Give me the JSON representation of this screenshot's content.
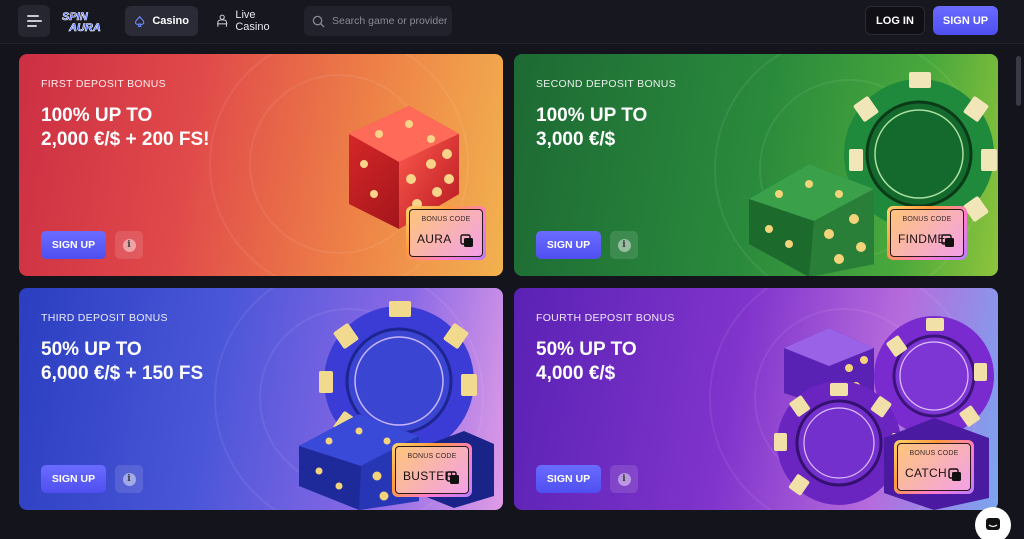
{
  "header": {
    "logo_text": "SPIN AURA",
    "tabs": [
      {
        "label": "Casino",
        "icon": "spade-icon",
        "active": true
      },
      {
        "label": "Live Casino",
        "icon": "dealer-icon",
        "active": false
      }
    ],
    "search": {
      "placeholder": "Search game or provider"
    },
    "login_label": "LOG IN",
    "signup_label": "SIGN UP"
  },
  "bonuses": [
    {
      "label": "FIRST DEPOSIT BONUS",
      "title_line1": "100% UP TO",
      "title_line2": "2,000 €/$ + 200 FS!",
      "signup_label": "SIGN UP",
      "code_label": "BONUS CODE",
      "code": "AURA",
      "color": "#e0494a"
    },
    {
      "label": "SECOND DEPOSIT BONUS",
      "title_line1": "100% UP TO",
      "title_line2": "3,000 €/$",
      "signup_label": "SIGN UP",
      "code_label": "BONUS CODE",
      "code": "FINDME",
      "color": "#2a8a3c"
    },
    {
      "label": "THIRD DEPOSIT BONUS",
      "title_line1": "50% UP TO",
      "title_line2": "6,000 €/$ + 150 FS",
      "signup_label": "SIGN UP",
      "code_label": "BONUS CODE",
      "code": "BUSTER",
      "color": "#4a56d8"
    },
    {
      "label": "FOURTH DEPOSIT BONUS",
      "title_line1": "50% UP TO",
      "title_line2": "4,000 €/$",
      "signup_label": "SIGN UP",
      "code_label": "BONUS CODE",
      "code": "CATCH",
      "color": "#8034cc"
    }
  ],
  "colors": {
    "accent": "#5b5cf6",
    "background": "#14141c"
  }
}
